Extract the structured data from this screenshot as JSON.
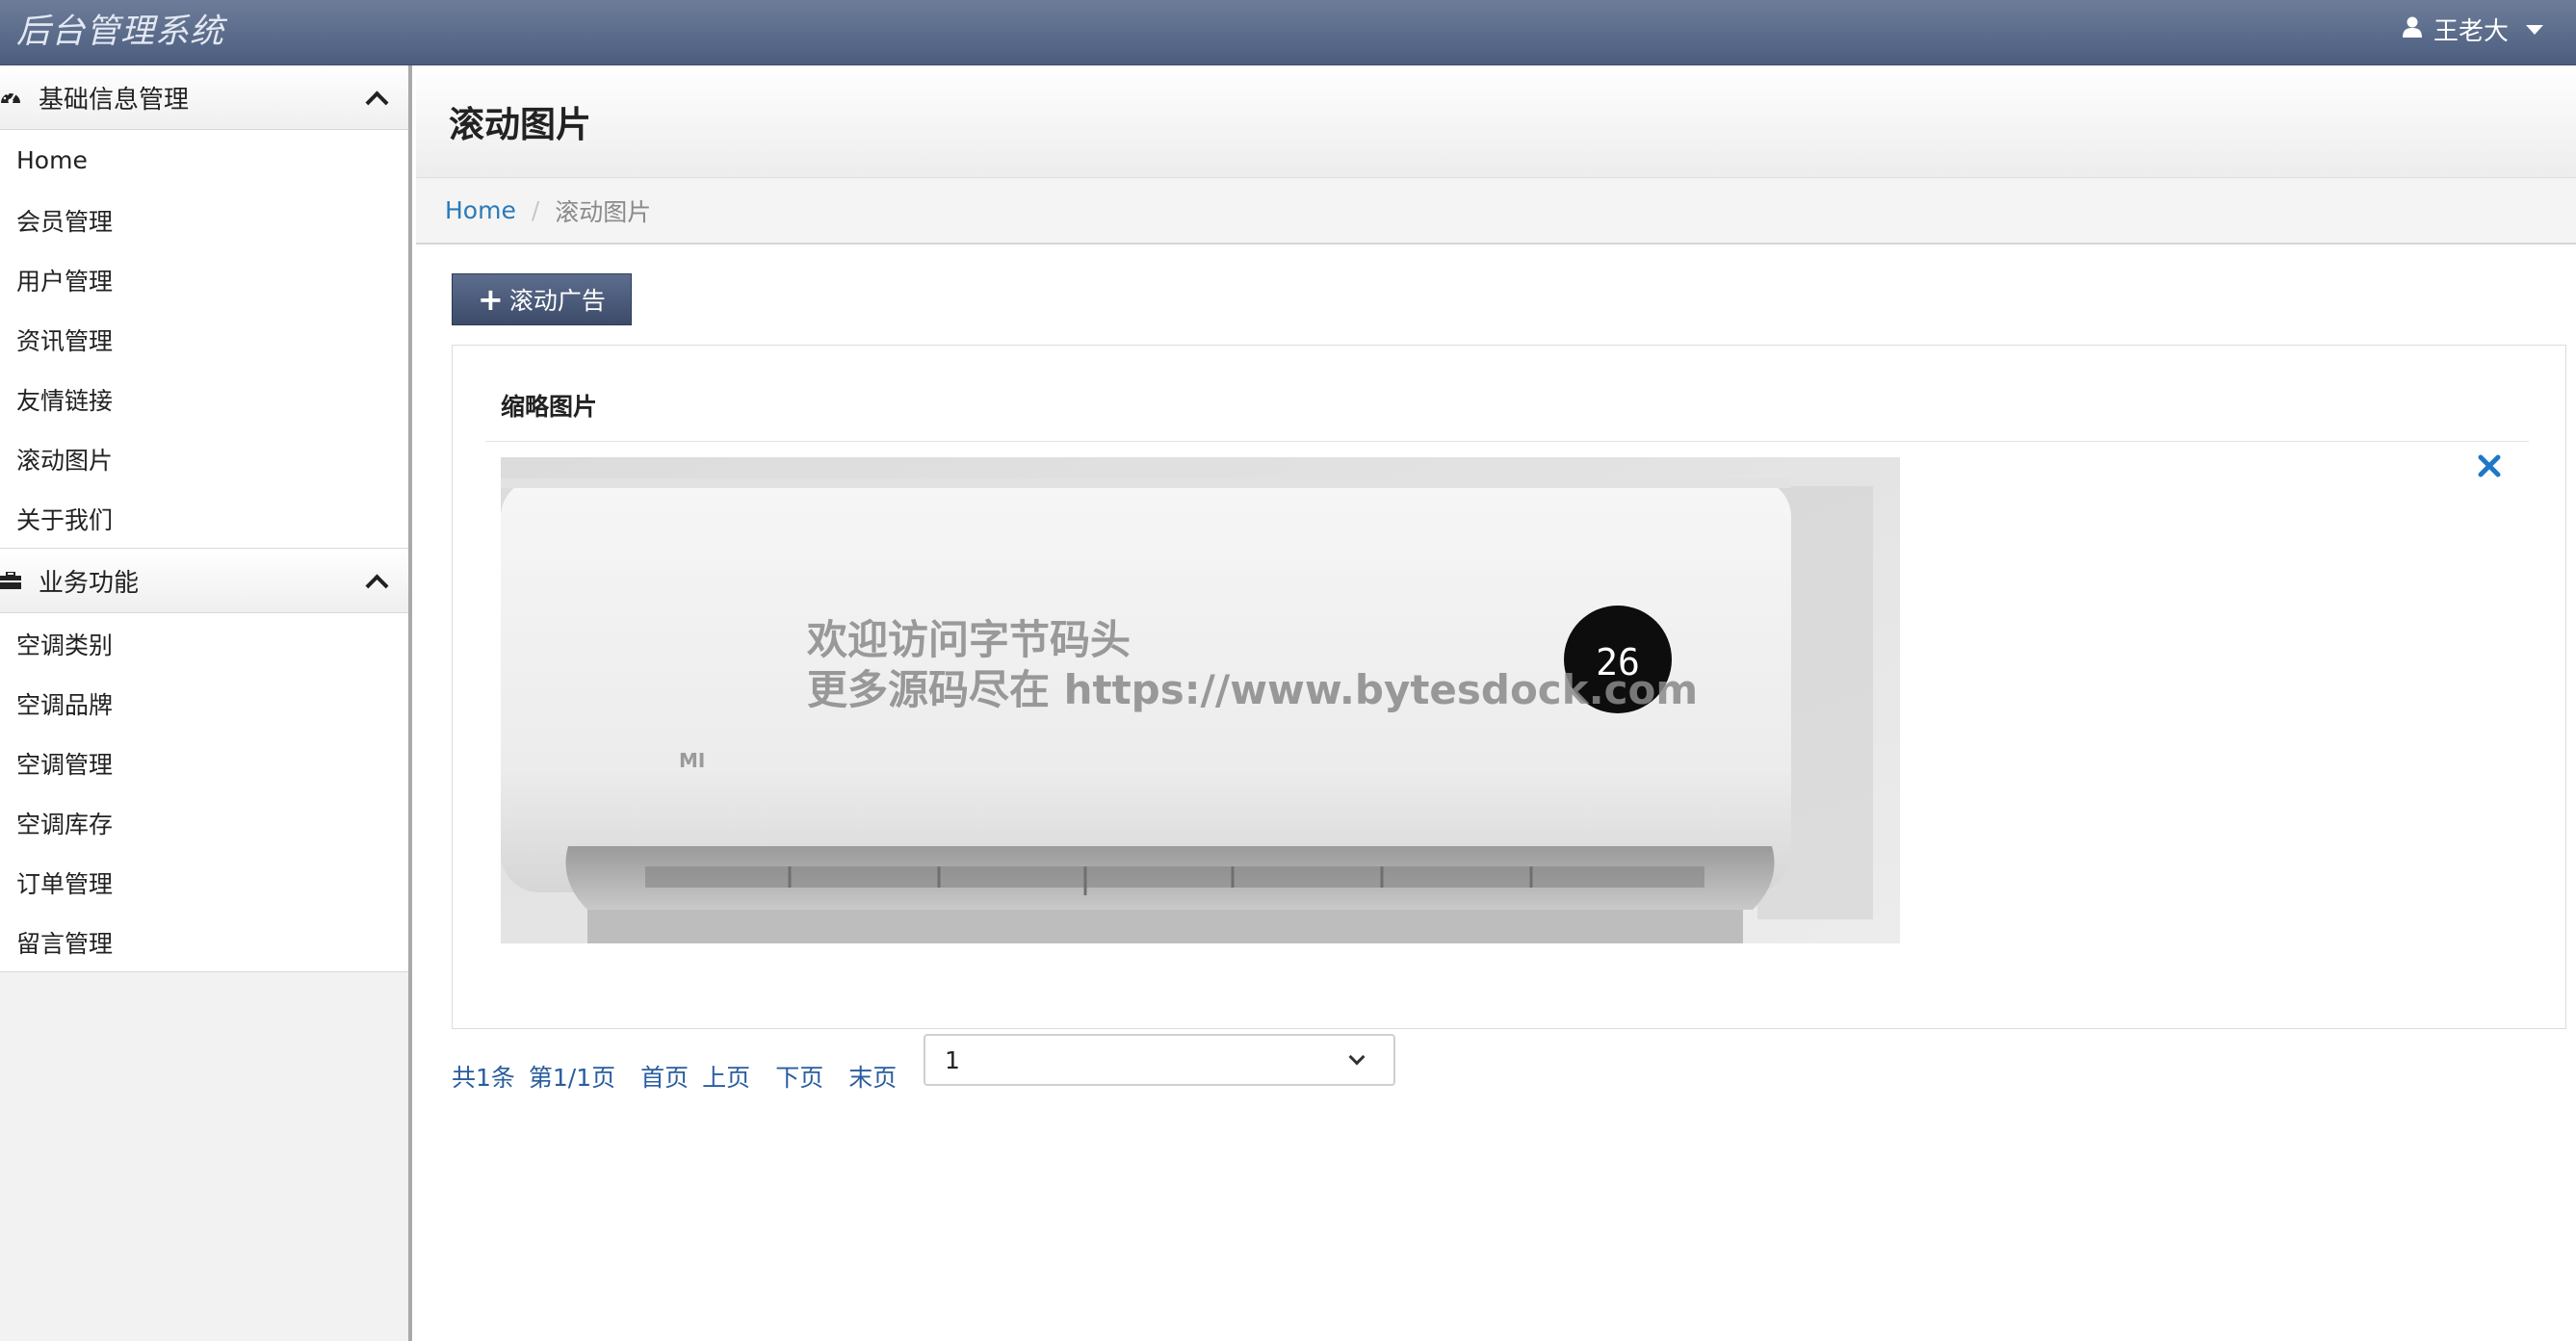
{
  "app": {
    "title": "后台管理系统"
  },
  "user": {
    "name": "王老大",
    "icon": "user-icon"
  },
  "sidebar": {
    "groups": [
      {
        "title": "基础信息管理",
        "icon": "dashboard-icon",
        "items": [
          {
            "label": "Home"
          },
          {
            "label": "会员管理"
          },
          {
            "label": "用户管理"
          },
          {
            "label": "资讯管理"
          },
          {
            "label": "友情链接"
          },
          {
            "label": "滚动图片"
          },
          {
            "label": "关于我们"
          }
        ]
      },
      {
        "title": "业务功能",
        "icon": "briefcase-icon",
        "items": [
          {
            "label": "空调类别"
          },
          {
            "label": "空调品牌"
          },
          {
            "label": "空调管理"
          },
          {
            "label": "空调库存"
          },
          {
            "label": "订单管理"
          },
          {
            "label": "留言管理"
          }
        ]
      }
    ]
  },
  "page": {
    "title": "滚动图片",
    "breadcrumb": {
      "home": "Home",
      "current": "滚动图片"
    },
    "add_button": "滚动广告",
    "table": {
      "header": "缩略图片"
    },
    "image": {
      "brand": "MI",
      "display": "26",
      "watermark_line1": "欢迎访问字节码头",
      "watermark_line2": "更多源码尽在  https://www.bytesdock.com"
    }
  },
  "pagination": {
    "total": "共1条",
    "page_info": "第1/1页",
    "first": "首页",
    "prev": "上页",
    "next": "下页",
    "last": "末页",
    "selected": "1"
  },
  "colors": {
    "navbar": "#5d6d8e",
    "link": "#2a7ab8",
    "close": "#1f77c9"
  }
}
